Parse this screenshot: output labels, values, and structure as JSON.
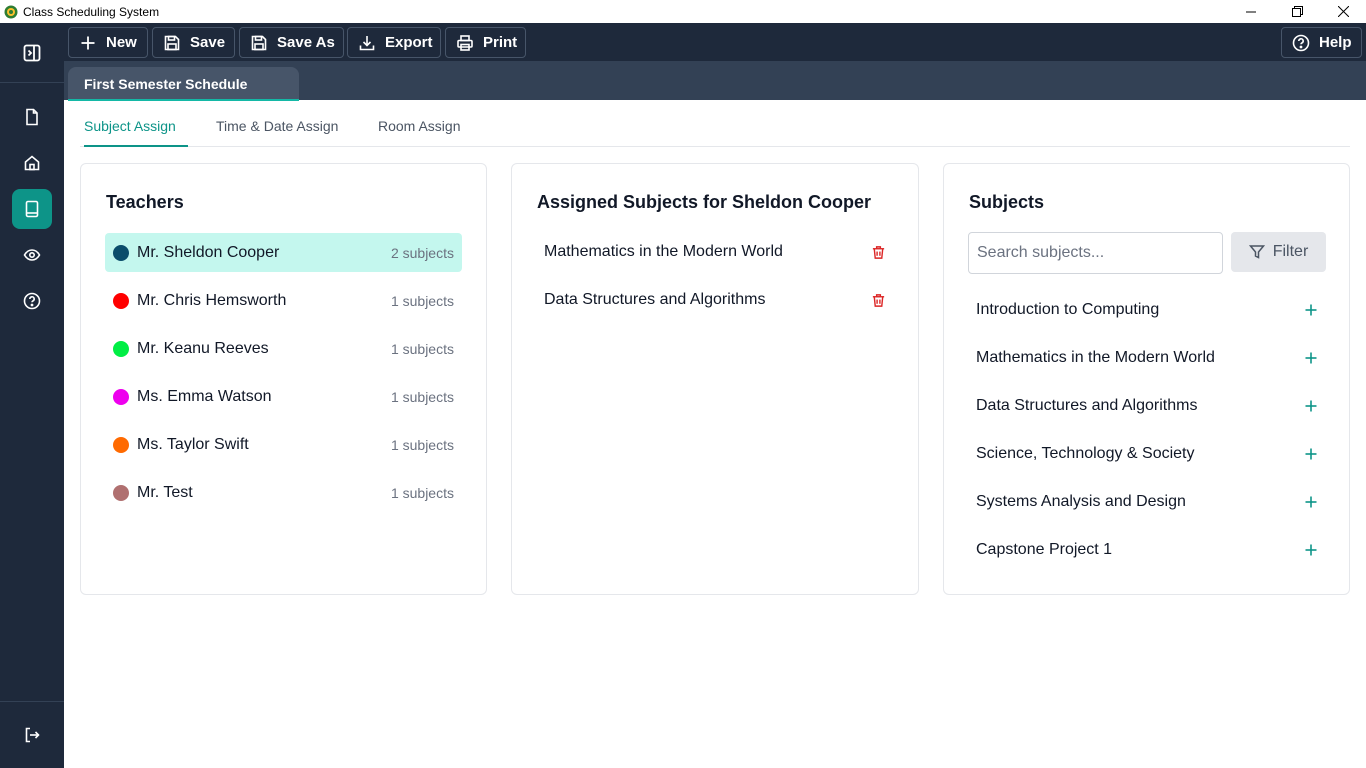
{
  "window": {
    "title": "Class Scheduling System"
  },
  "toolbar": {
    "new_label": "New",
    "save_label": "Save",
    "save_as_label": "Save As",
    "export_label": "Export",
    "print_label": "Print",
    "help_label": "Help"
  },
  "document_tab": {
    "label": "First Semester Schedule"
  },
  "subtabs": {
    "subject_assign": "Subject Assign",
    "time_date_assign": "Time & Date Assign",
    "room_assign": "Room Assign"
  },
  "teachers_panel": {
    "title": "Teachers",
    "items": [
      {
        "name": "Mr. Sheldon Cooper",
        "count": "2 subjects",
        "color": "#0b4d6b",
        "selected": true
      },
      {
        "name": "Mr. Chris Hemsworth",
        "count": "1 subjects",
        "color": "#ff0000"
      },
      {
        "name": "Mr. Keanu Reeves",
        "count": "1 subjects",
        "color": "#00ee44"
      },
      {
        "name": "Ms. Emma Watson",
        "count": "1 subjects",
        "color": "#ee00ee"
      },
      {
        "name": "Ms. Taylor Swift",
        "count": "1 subjects",
        "color": "#ff6a00"
      },
      {
        "name": "Mr. Test",
        "count": "1 subjects",
        "color": "#b07070"
      }
    ]
  },
  "assigned_panel": {
    "title": "Assigned Subjects for Sheldon Cooper",
    "items": [
      {
        "name": "Mathematics in the Modern World"
      },
      {
        "name": "Data Structures and Algorithms"
      }
    ]
  },
  "subjects_panel": {
    "title": "Subjects",
    "search_placeholder": "Search subjects...",
    "filter_label": "Filter",
    "items": [
      {
        "name": "Introduction to Computing"
      },
      {
        "name": "Mathematics in the Modern World"
      },
      {
        "name": "Data Structures and Algorithms"
      },
      {
        "name": "Science, Technology & Society"
      },
      {
        "name": "Systems Analysis and Design"
      },
      {
        "name": "Capstone Project 1"
      }
    ]
  },
  "colors": {
    "accent": "#0d9488",
    "sidebar_bg": "#1e293b",
    "selected_row_bg": "#c4f7ee",
    "delete_icon": "#dc2626"
  }
}
